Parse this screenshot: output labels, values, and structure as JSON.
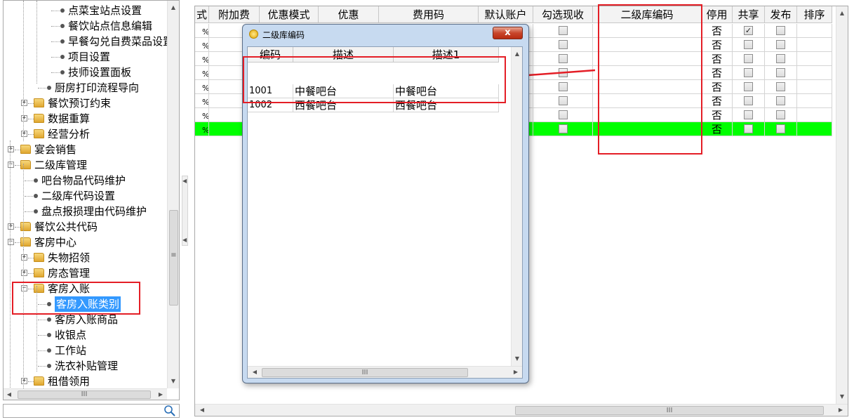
{
  "tree": {
    "items": [
      {
        "label": "点菜宝站点设置",
        "kind": "leaf"
      },
      {
        "label": "餐饮站点信息编辑",
        "kind": "leaf"
      },
      {
        "label": "早餐勾兑自费菜品设置",
        "kind": "leaf"
      },
      {
        "label": "项目设置",
        "kind": "leaf"
      },
      {
        "label": "技师设置面板",
        "kind": "leaf"
      },
      {
        "label": "厨房打印流程导向",
        "kind": "leaf"
      },
      {
        "label": "餐饮预订约束",
        "kind": "folder",
        "expander": "+"
      },
      {
        "label": "数据重算",
        "kind": "folder",
        "expander": "+"
      },
      {
        "label": "经营分析",
        "kind": "folder",
        "expander": "+"
      },
      {
        "label": "宴会销售",
        "kind": "folder",
        "expander": "+"
      },
      {
        "label": "二级库管理",
        "kind": "folder",
        "expander": "-"
      },
      {
        "label": "吧台物品代码维护",
        "kind": "leaf"
      },
      {
        "label": "二级库代码设置",
        "kind": "leaf"
      },
      {
        "label": "盘点报损理由代码维护",
        "kind": "leaf"
      },
      {
        "label": "餐饮公共代码",
        "kind": "folder",
        "expander": "+"
      },
      {
        "label": "客房中心",
        "kind": "folder",
        "expander": "-"
      },
      {
        "label": "失物招领",
        "kind": "folder",
        "expander": "+"
      },
      {
        "label": "房态管理",
        "kind": "folder",
        "expander": "+"
      },
      {
        "label": "客房入账",
        "kind": "folder",
        "expander": "-"
      },
      {
        "label": "客房入账类别",
        "kind": "leaf",
        "selected": true
      },
      {
        "label": "客房入账商品",
        "kind": "leaf"
      },
      {
        "label": "收银点",
        "kind": "leaf"
      },
      {
        "label": "工作站",
        "kind": "leaf"
      },
      {
        "label": "洗衣补贴管理",
        "kind": "leaf"
      },
      {
        "label": "租借领用",
        "kind": "folder",
        "expander": "+"
      }
    ]
  },
  "search": {
    "icon": "search-icon",
    "placeholder": ""
  },
  "grid": {
    "columns": [
      "式",
      "附加费",
      "优惠模式",
      "优惠",
      "费用码",
      "默认账户",
      "勾选现收",
      "二级库编码",
      "停用",
      "共享",
      "发布",
      "排序"
    ],
    "rows": [
      {
        "unit": "%",
        "stop": "否",
        "share_checked": true
      },
      {
        "unit": "%",
        "stop": "否",
        "share_checked": false
      },
      {
        "unit": "%",
        "stop": "否",
        "share_checked": false
      },
      {
        "unit": "%",
        "stop": "否",
        "share_checked": false
      },
      {
        "unit": "%",
        "stop": "否",
        "share_checked": false
      },
      {
        "unit": "%",
        "stop": "否",
        "share_checked": false
      },
      {
        "unit": "%",
        "stop": "否",
        "share_checked": false
      },
      {
        "unit": "%",
        "stop": "否",
        "share_checked": false,
        "highlighted": true
      }
    ],
    "highlight_color": "#00ff00"
  },
  "popup": {
    "title": "二级库编码",
    "close_label": "x",
    "columns": [
      "编码",
      "描述",
      "描述1"
    ],
    "rows": [
      {
        "code": "1001",
        "desc": "中餐吧台",
        "desc1": "中餐吧台"
      },
      {
        "code": "1002",
        "desc": "西餐吧台",
        "desc1": "西餐吧台"
      }
    ]
  },
  "annotation_color": "#e41e26"
}
